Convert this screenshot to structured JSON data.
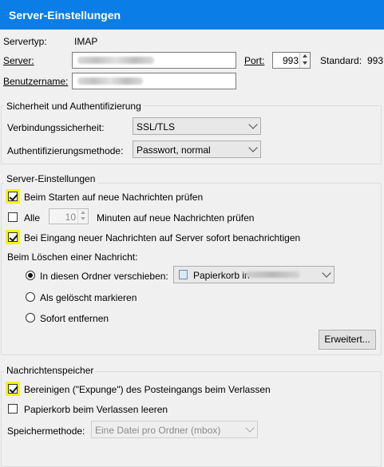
{
  "header": {
    "title": "Server-Einstellungen"
  },
  "server": {
    "type_label": "Servertyp:",
    "type_value": "IMAP",
    "server_label": "Server:",
    "port_label": "Port:",
    "port_value": "993",
    "standard_label": "Standard:",
    "standard_value": "993",
    "username_label": "Benutzername:"
  },
  "security": {
    "legend": "Sicherheit und Authentifizierung",
    "connection_label": "Verbindungssicherheit:",
    "connection_value": "SSL/TLS",
    "auth_label": "Authentifizierungsmethode:",
    "auth_value": "Passwort, normal"
  },
  "server_settings": {
    "legend": "Server-Einstellungen",
    "check_on_start": {
      "label": "Beim Starten auf neue Nachrichten prüfen",
      "checked": true
    },
    "every": {
      "label": "Alle",
      "checked": false,
      "minutes_value": "10",
      "suffix": "Minuten auf neue Nachrichten prüfen"
    },
    "notify": {
      "label": "Bei Eingang neuer Nachrichten auf Server sofort benachrichtigen",
      "checked": true
    },
    "delete_label": "Beim Löschen einer Nachricht:",
    "move_option": {
      "label": "In diesen Ordner verschieben:",
      "selected": true
    },
    "folder_select_value": "Papierkorb in",
    "mark_option": {
      "label": "Als gelöscht markieren",
      "selected": false
    },
    "remove_option": {
      "label": "Sofort entfernen",
      "selected": false
    },
    "advanced_button": "Erweitert..."
  },
  "storage": {
    "legend": "Nachrichtenspeicher",
    "expunge": {
      "label": "Bereinigen (\"Expunge\") des Posteingangs beim Verlassen",
      "checked": true
    },
    "empty_trash": {
      "label": "Papierkorb beim Verlassen leeren",
      "checked": false
    },
    "method_label": "Speichermethode:",
    "method_value": "Eine Datei pro Ordner (mbox)"
  },
  "colors": {
    "header_bg": "#0a7ee6",
    "highlight": "#f5f500"
  }
}
